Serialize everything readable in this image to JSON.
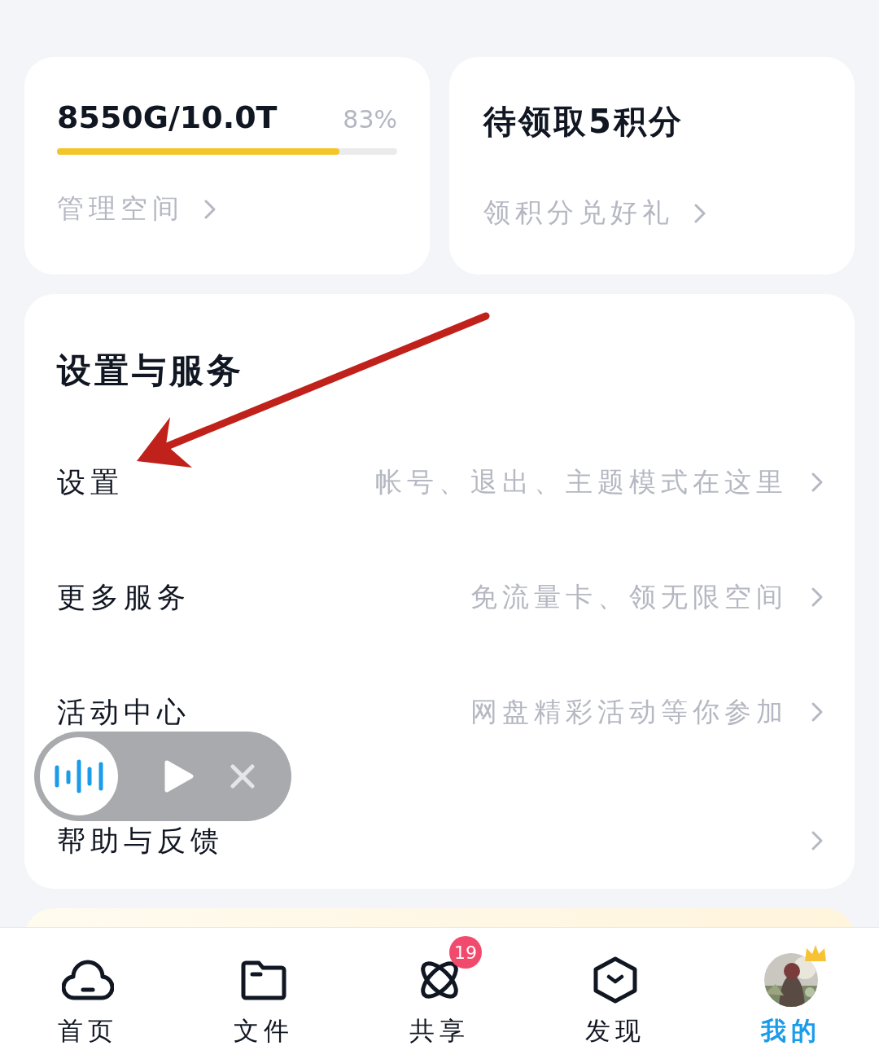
{
  "storage_card": {
    "usage": "8550G/10.0T",
    "percent": "83%",
    "level": 0.83,
    "link": "管理空间"
  },
  "points_card": {
    "title": "待领取5积分",
    "link": "领积分兑好礼"
  },
  "settings_section": {
    "title": "设置与服务",
    "rows": [
      {
        "label": "设置",
        "hint": "帐号、退出、主题模式在这里"
      },
      {
        "label": "更多服务",
        "hint": "免流量卡、领无限空间"
      },
      {
        "label": "活动中心",
        "hint": "网盘精彩活动等你参加"
      },
      {
        "label": "帮助与反馈"
      }
    ]
  },
  "tabs": [
    {
      "label": "首页",
      "kind": "cloud",
      "selected": false
    },
    {
      "label": "文件",
      "kind": "folder",
      "selected": false
    },
    {
      "label": "共享",
      "kind": "orbit",
      "selected": false,
      "badge": "19"
    },
    {
      "label": "发现",
      "kind": "hexagon",
      "selected": false
    },
    {
      "label": "我的",
      "kind": "avatar",
      "selected": true
    }
  ]
}
